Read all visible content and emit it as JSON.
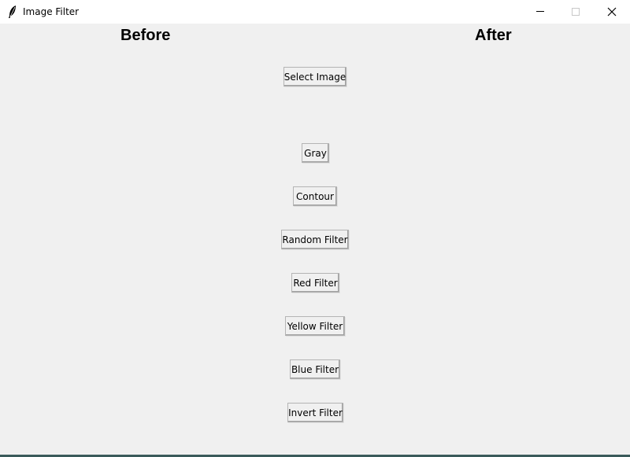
{
  "window": {
    "title": "Image Filter",
    "app_icon": "feather-icon",
    "controls": [
      "minimize-icon",
      "maximize-icon",
      "close-icon"
    ]
  },
  "headings": {
    "before": "Before",
    "after": "After"
  },
  "buttons": {
    "select_image": "Select Image",
    "gray": "Gray",
    "contour": "Contour",
    "random_filter": "Random Filter",
    "red_filter": "Red Filter",
    "yellow_filter": "Yellow Filter",
    "blue_filter": "Blue Filter",
    "invert_filter": "Invert Filter"
  }
}
